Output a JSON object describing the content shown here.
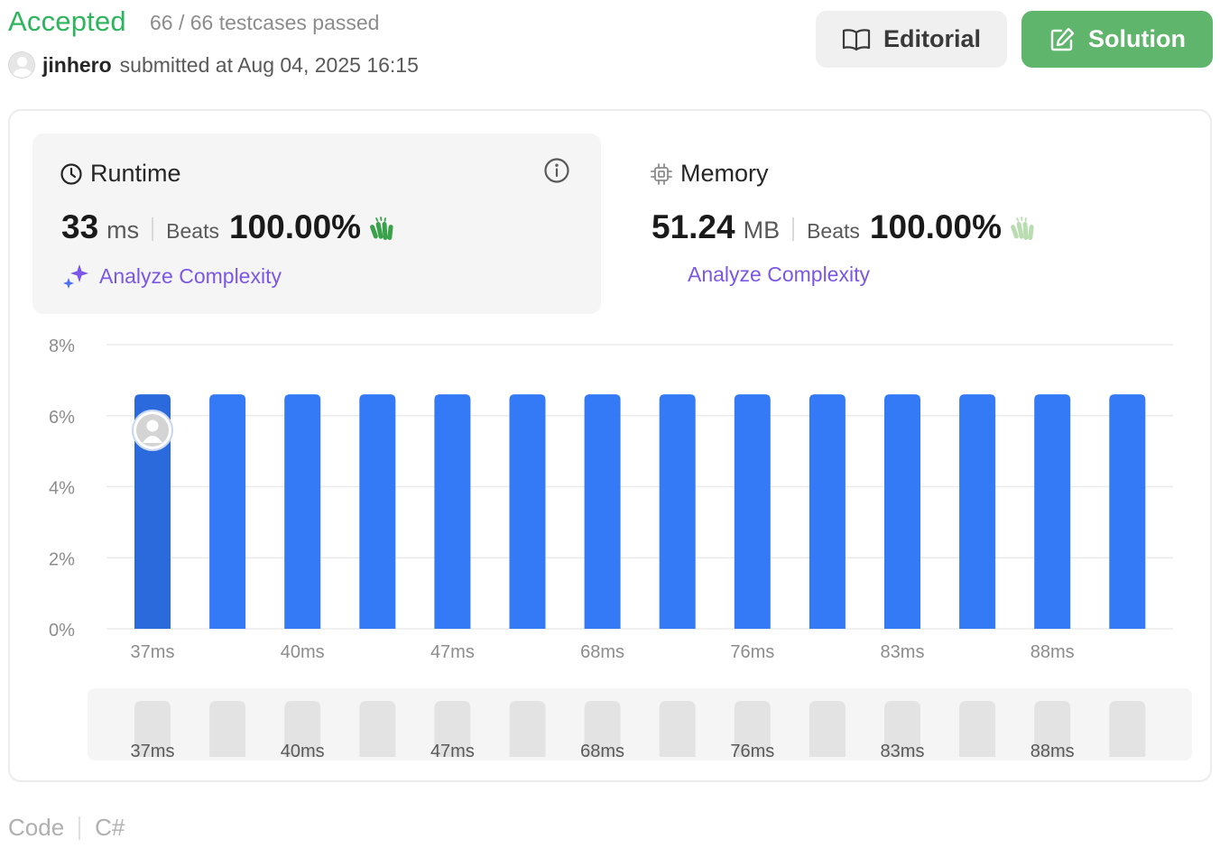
{
  "header": {
    "status": "Accepted",
    "testcases": "66 / 66 testcases passed",
    "username": "jinhero",
    "submitted_text": "submitted at Aug 04, 2025 16:15"
  },
  "buttons": {
    "editorial": "Editorial",
    "solution": "Solution"
  },
  "runtime": {
    "title": "Runtime",
    "value": "33",
    "unit": "ms",
    "beats_label": "Beats",
    "beats_pct": "100.00%",
    "analyze": "Analyze Complexity"
  },
  "memory": {
    "title": "Memory",
    "value": "51.24",
    "unit": "MB",
    "beats_label": "Beats",
    "beats_pct": "100.00%",
    "analyze": "Analyze Complexity"
  },
  "chart_data": {
    "type": "bar",
    "y_ticks": [
      "8%",
      "6%",
      "4%",
      "2%",
      "0%"
    ],
    "ylim": [
      0,
      8
    ],
    "x_tick_labels": [
      "37ms",
      "40ms",
      "47ms",
      "68ms",
      "76ms",
      "83ms",
      "88ms"
    ],
    "bar_count": 14,
    "values": [
      6.6,
      6.6,
      6.6,
      6.6,
      6.6,
      6.6,
      6.6,
      6.6,
      6.6,
      6.6,
      6.6,
      6.6,
      6.6,
      6.6
    ],
    "highlight_index": 0,
    "colors": {
      "bar": "#3479f6",
      "highlight": "#2a6adc",
      "grid": "#ebebeb",
      "overview_bar": "#e3e3e3"
    }
  },
  "footer": {
    "code_label": "Code",
    "language": "C#"
  },
  "colors": {
    "accepted": "#2db55d",
    "solution_button": "#5fb56b",
    "analyze_text": "#7b57e6"
  }
}
